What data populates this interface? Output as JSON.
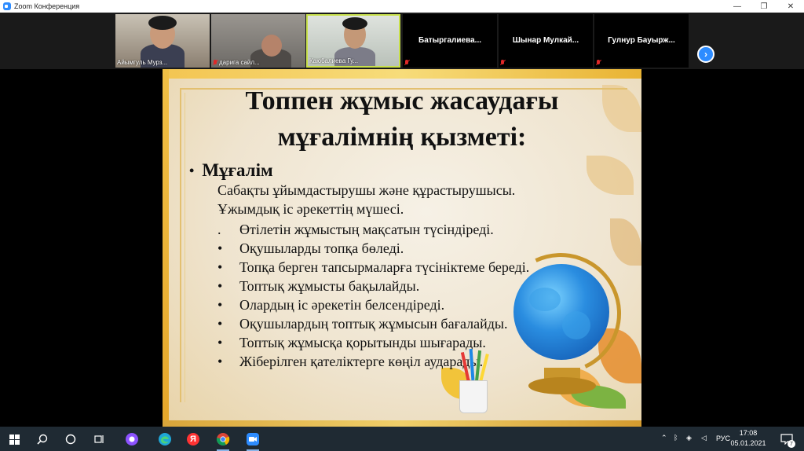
{
  "window": {
    "title": "Zoom Конференция",
    "controls": {
      "minimize": "—",
      "restore": "❐",
      "close": "✕"
    }
  },
  "gallery": {
    "participants": [
      {
        "name": "Айымгуль Мурз...",
        "muted": false,
        "video": true
      },
      {
        "name": "дарига сайл...",
        "muted": true,
        "video": true
      },
      {
        "name": "Каюбалиева Гу...",
        "muted": false,
        "video": true,
        "active_speaker": true
      },
      {
        "name": "Батыргалиева...",
        "muted": true,
        "video": false
      },
      {
        "name": "Шынар Мулкай...",
        "muted": true,
        "video": false
      },
      {
        "name": "Гулнур Бауырж...",
        "muted": true,
        "video": false
      }
    ],
    "next_page_icon": "chevron-right-icon"
  },
  "slide": {
    "title_line1": "Топпен жұмыс жасаудағы",
    "title_line2": "мұғалімнің қызметі:",
    "heading_bullet": "•",
    "heading": "Мұғалім",
    "intro": [
      "Сабақты ұйымдастырушы және құрастырушысы.",
      "Ұжымдық  іс әрекеттің мүшесі."
    ],
    "items": [
      {
        "bullet": ".",
        "text": "Өтілетін жұмыстың мақсатын түсіндіреді."
      },
      {
        "bullet": "•",
        "text": "Оқушыларды топқа бөледі."
      },
      {
        "bullet": "•",
        "text": "Топқа берген тапсырмаларға түсініктеме береді."
      },
      {
        "bullet": "•",
        "text": "Топтық жұмысты бақылайды."
      },
      {
        "bullet": "•",
        "text": "Олардың іс әрекетін белсендіреді."
      },
      {
        "bullet": "•",
        "text": "Оқушылардың топтық жұмысын бағалайды."
      },
      {
        "bullet": "•",
        "text": "Топтық жұмысқа қорытынды шығарады."
      },
      {
        "bullet": "•",
        "text": "Жіберілген қателіктерге көңіл аударады."
      }
    ]
  },
  "taskbar": {
    "apps": [
      "windows-start-icon",
      "search-icon",
      "cortana-icon",
      "task-view-icon",
      "alice-icon",
      "edge-icon",
      "yandex-browser-icon",
      "chrome-icon",
      "zoom-icon"
    ],
    "yandex_label": "Я",
    "language": "РУС",
    "time": "17:08",
    "date": "05.01.2021",
    "notification_count": "7"
  },
  "colors": {
    "zoom_blue": "#2d8cff",
    "taskbar": "#1f2a33",
    "active_speaker_border": "#c8e04b",
    "muted_red": "#e02828"
  }
}
